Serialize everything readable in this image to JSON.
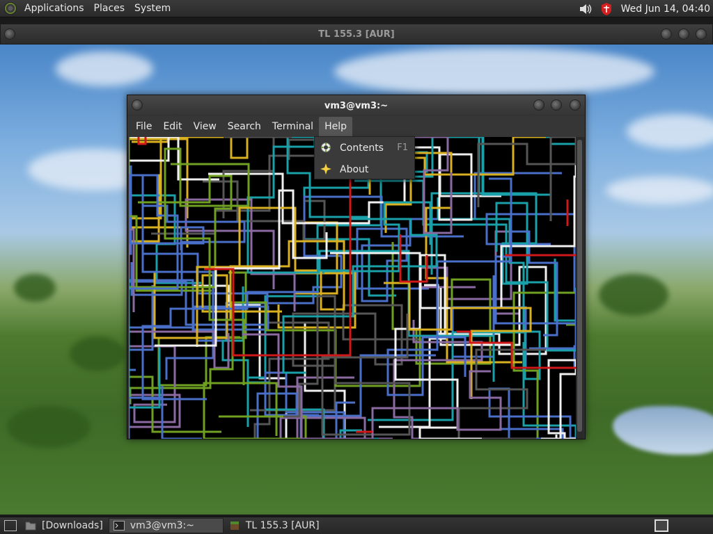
{
  "top_panel": {
    "menus": [
      "Applications",
      "Places",
      "System"
    ],
    "clock": "Wed Jun 14, 04:40"
  },
  "background_window": {
    "title": "TL 155.3 [AUR]"
  },
  "terminal": {
    "title": "vm3@vm3:~",
    "menu": [
      "File",
      "Edit",
      "View",
      "Search",
      "Terminal",
      "Help"
    ]
  },
  "help_menu": {
    "items": [
      {
        "label": "Contents",
        "accel": "F1",
        "icon": "help-lifebuoy-icon"
      },
      {
        "label": "About",
        "accel": "",
        "icon": "star-about-icon"
      }
    ]
  },
  "taskbar": {
    "items": [
      {
        "label": "[Downloads]",
        "icon": "folder-icon",
        "active": false
      },
      {
        "label": "vm3@vm3:~",
        "icon": "terminal-icon",
        "active": true
      },
      {
        "label": "TL 155.3 [AUR]",
        "icon": "minecraft-block-icon",
        "active": false
      }
    ]
  },
  "colors": {
    "pipe_red": "#d01818",
    "pipe_cyan": "#1aa0a8",
    "pipe_blue": "#4a6fc8",
    "pipe_green": "#6fa022",
    "pipe_yellow": "#d8b020",
    "pipe_purple": "#8a6aa0",
    "pipe_white": "#f0f0f0",
    "pipe_gray": "#555555"
  }
}
